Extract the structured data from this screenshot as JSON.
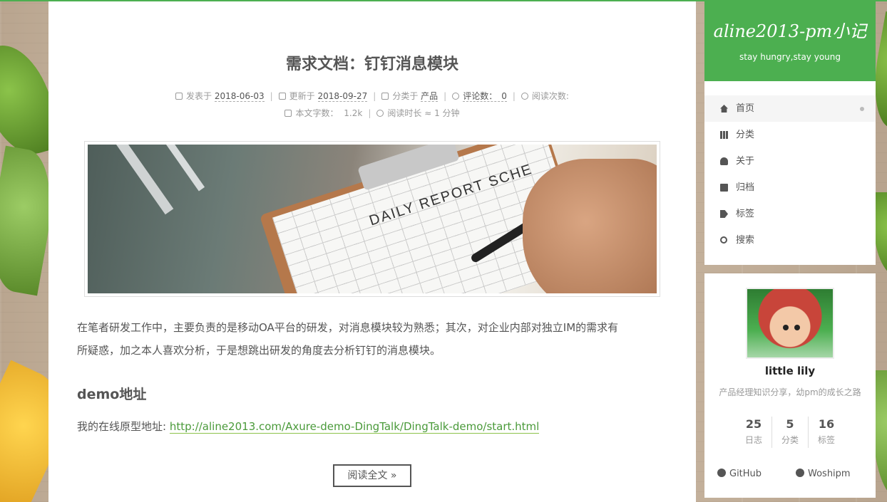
{
  "post": {
    "title": "需求文档：钉钉消息模块",
    "meta": {
      "posted_label": "发表于",
      "posted_date": "2018-06-03",
      "updated_label": "更新于",
      "updated_date": "2018-09-27",
      "category_label": "分类于",
      "category": "产品",
      "comments_label": "评论数：",
      "comments_count": "0",
      "views_label": "阅读次数:",
      "wordcount_label": "本文字数：",
      "wordcount": "1.2k",
      "readtime_label": "阅读时长 ≈",
      "readtime": "1 分钟"
    },
    "hero_image_text": "DAILY REPORT SCHE",
    "intro_line1": "在笔者研发工作中，主要负责的是移动OA平台的研发，对消息模块较为熟悉；其次，对企业内部对独立IM的需求有",
    "intro_line2": "所疑惑，加之本人喜欢分析，于是想跳出研发的角度去分析钉钉的消息模块。",
    "section_heading": "demo地址",
    "demo_label": "我的在线原型地址:",
    "demo_url": "http://aline2013.com/Axure-demo-DingTalk/DingTalk-demo/start.html",
    "read_more": "阅读全文 »"
  },
  "site": {
    "title": "aline2013-pm小记",
    "subtitle": "stay hungry,stay young"
  },
  "menu": {
    "items": [
      {
        "label": "首页",
        "icon": "home-icon"
      },
      {
        "label": "分类",
        "icon": "th-icon"
      },
      {
        "label": "关于",
        "icon": "user-icon"
      },
      {
        "label": "归档",
        "icon": "archive-icon"
      },
      {
        "label": "标签",
        "icon": "tags-icon"
      },
      {
        "label": "搜索",
        "icon": "search-icon"
      }
    ]
  },
  "profile": {
    "name": "little lily",
    "description": "产品经理知识分享，幼pm的成长之路",
    "stats": [
      {
        "count": "25",
        "label": "日志"
      },
      {
        "count": "5",
        "label": "分类"
      },
      {
        "count": "16",
        "label": "标签"
      }
    ],
    "links": {
      "github": "GitHub",
      "woshipm": "Woshipm"
    }
  },
  "colors": {
    "accent": "#4caf50",
    "link": "#4a9a3a"
  }
}
